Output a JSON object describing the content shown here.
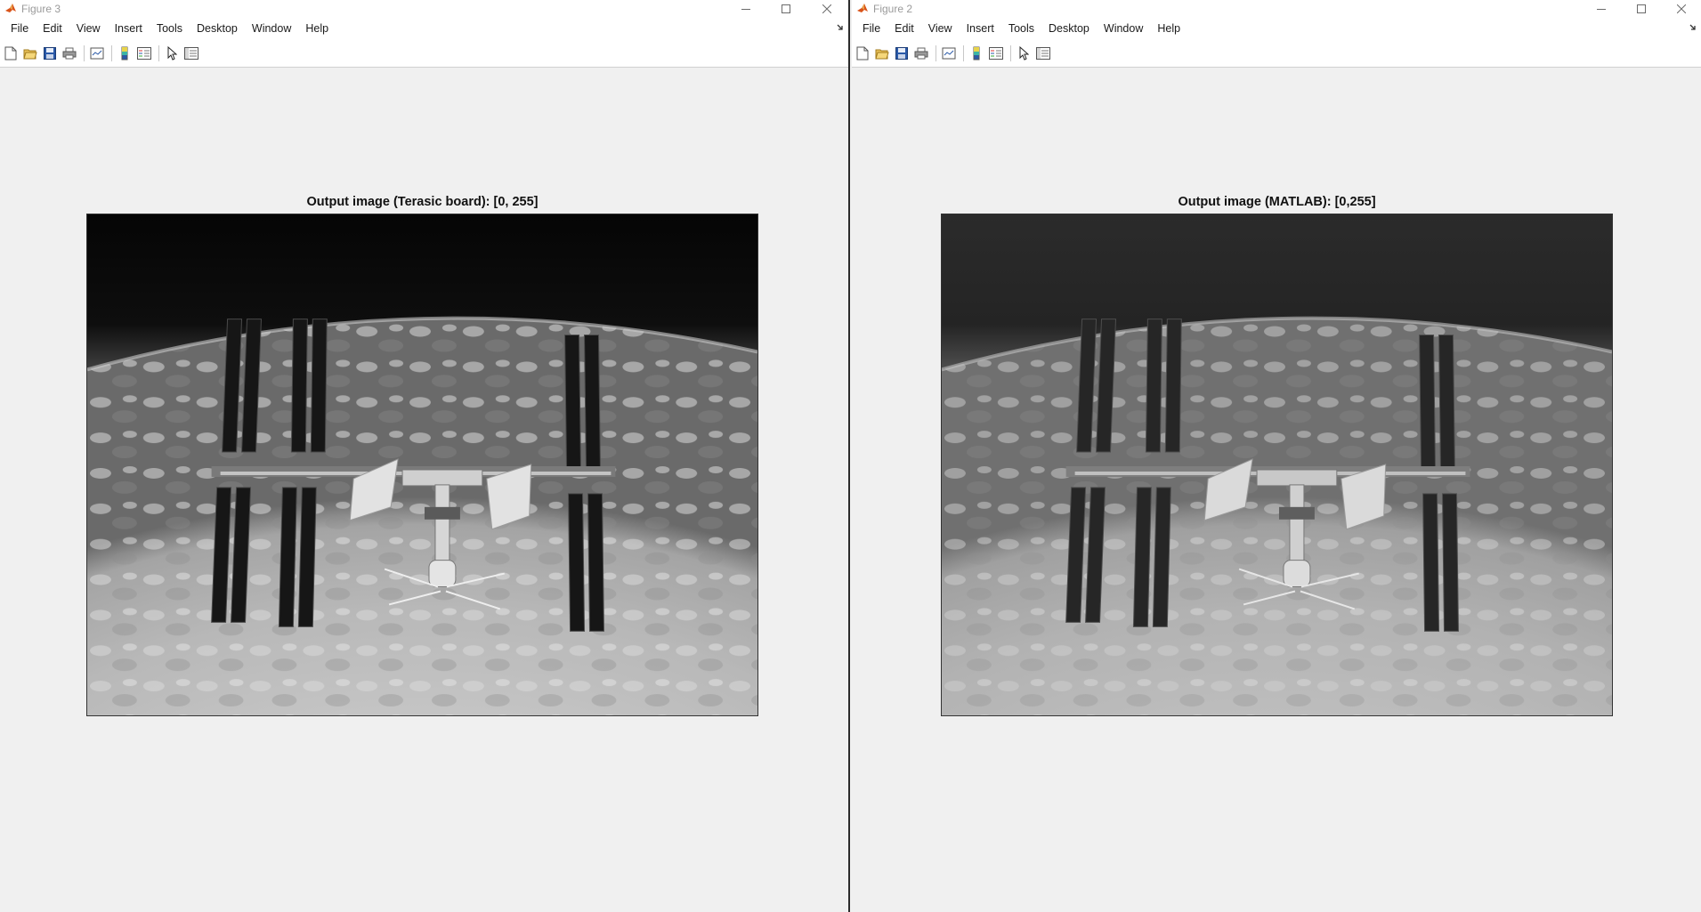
{
  "windows": [
    {
      "id": "left",
      "title": "Figure 3",
      "menu": [
        "File",
        "Edit",
        "View",
        "Insert",
        "Tools",
        "Desktop",
        "Window",
        "Help"
      ],
      "axes_title": "Output image (Terasic board): [0, 255]"
    },
    {
      "id": "right",
      "title": "Figure 2",
      "menu": [
        "File",
        "Edit",
        "View",
        "Insert",
        "Tools",
        "Desktop",
        "Window",
        "Help"
      ],
      "axes_title": "Output image (MATLAB): [0,255]"
    }
  ],
  "toolbar_icons": [
    "new-figure-icon",
    "open-file-icon",
    "save-icon",
    "print-icon",
    "link-plot-icon",
    "insert-colorbar-icon",
    "insert-legend-icon",
    "edit-plot-icon",
    "property-inspector-icon"
  ],
  "colors": {
    "accent_matlab": "#d95319",
    "window_bg": "#f0f0f0",
    "space": "#050505"
  }
}
